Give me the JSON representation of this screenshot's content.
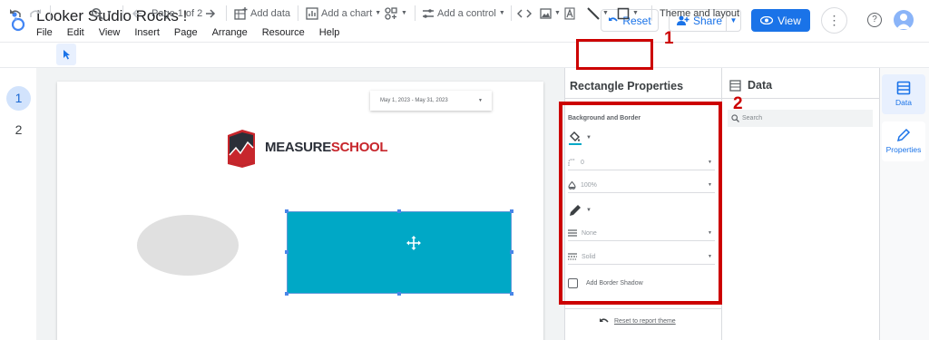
{
  "header": {
    "title": "Looker Studio Rocks !",
    "menu": [
      "File",
      "Edit",
      "View",
      "Insert",
      "Page",
      "Arrange",
      "Resource",
      "Help"
    ],
    "reset_label": "Reset",
    "share_label": "Share",
    "view_label": "View"
  },
  "toolbar": {
    "page_indicator": "Page 1 of 2",
    "add_data": "Add data",
    "add_chart": "Add a chart",
    "add_control": "Add a control",
    "theme_layout": "Theme and layout"
  },
  "pages": [
    "1",
    "2"
  ],
  "canvas": {
    "date_range": "May 1, 2023 - May 31, 2023",
    "logo_text_a": "MEASURE",
    "logo_text_b": "SCHOOL",
    "rect_color": "#00a8c6",
    "ellipse_color": "#e0e0e0"
  },
  "properties": {
    "title": "Rectangle Properties",
    "section": "Background and Border",
    "border_radius": "0",
    "opacity": "100%",
    "border_weight": "None",
    "border_style": "Solid",
    "shadow_label": "Add Border Shadow",
    "reset_theme": "Reset to report theme"
  },
  "data_panel": {
    "title": "Data",
    "search_placeholder": "Search"
  },
  "side_nav": {
    "data": "Data",
    "properties": "Properties"
  },
  "annotations": {
    "one": "1",
    "two": "2",
    "color": "#cc0000"
  }
}
